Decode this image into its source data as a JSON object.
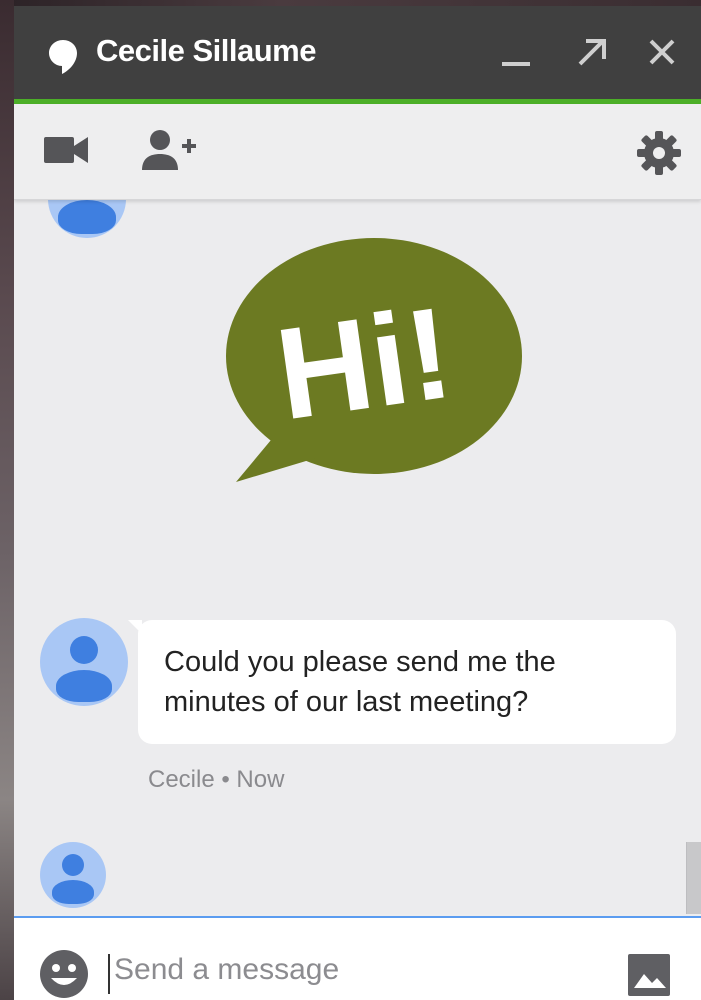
{
  "window": {
    "contact_name": "Cecile Sillaume",
    "accent_color": "#4caf28",
    "titlebar_color": "#404040",
    "icons": {
      "title": "hangouts-icon",
      "minimize": "minimize-icon",
      "popout": "popout-arrow-icon",
      "close": "close-icon"
    }
  },
  "toolbar": {
    "icons": [
      "video-call-icon",
      "add-person-icon",
      "gear-icon"
    ]
  },
  "conversation": {
    "sticker": {
      "text": "Hi!",
      "color": "#6c7a22"
    },
    "messages": [
      {
        "sender": "Cecile",
        "text_line1": "Could you please send me the",
        "text_line2": "minutes of our last meeting?",
        "meta": "Cecile • Now"
      }
    ],
    "avatar_color": "#3f7fe0",
    "avatar_bg": "#a9c7f5"
  },
  "composer": {
    "placeholder": "Send a message",
    "icons": [
      "emoji-icon",
      "image-icon"
    ],
    "focus_color": "#5b9cf0"
  }
}
